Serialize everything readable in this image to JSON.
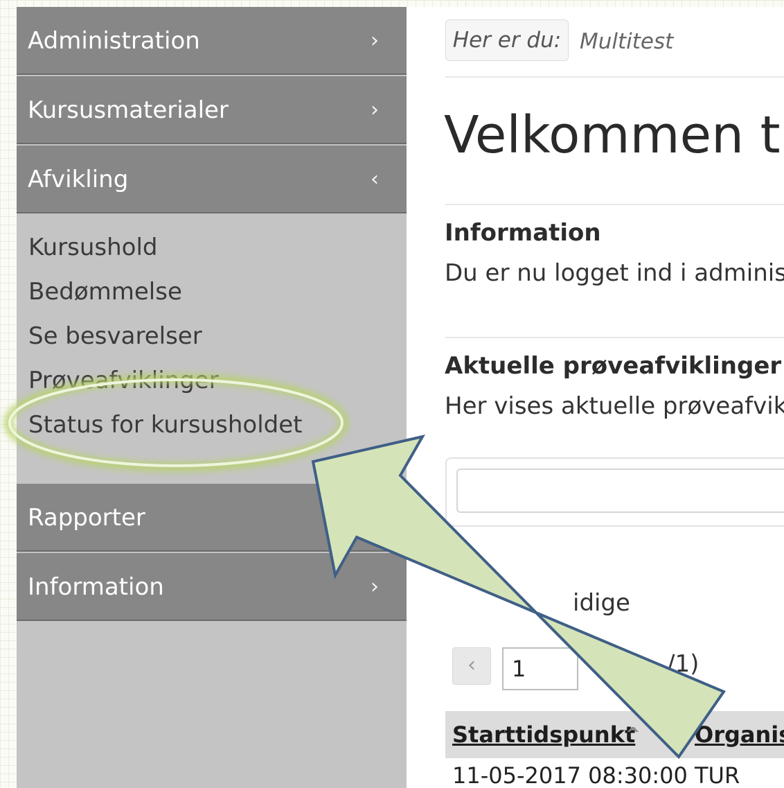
{
  "sidebar": {
    "items": [
      {
        "label": "Administration",
        "chevron": "›"
      },
      {
        "label": "Kursusmaterialer",
        "chevron": "›"
      },
      {
        "label": "Afvikling",
        "chevron": "‹"
      },
      {
        "label": "Rapporter",
        "chevron": ""
      },
      {
        "label": "Information",
        "chevron": "›"
      }
    ],
    "submenu": [
      "Kursushold",
      "Bedømmelse",
      "Se besvarelser",
      "Prøveafviklinger",
      "Status for kursusholdet"
    ]
  },
  "breadcrumb": {
    "label": "Her er du:",
    "current": "Multitest"
  },
  "main": {
    "welcome": "Velkommen til",
    "info_title": "Information",
    "info_text": "Du er nu logget ind i adminis",
    "current_title": "Aktuelle prøveafviklinger",
    "current_text": "Her vises aktuelle prøveafvik",
    "earlier_label": "idige",
    "pager": {
      "prev": "‹",
      "page": "1",
      "count": "/1)"
    },
    "table": {
      "headers": [
        "Starttidspunkt",
        "Organis"
      ],
      "sort_indicator": "^",
      "rows": [
        [
          "11-05-2017 08:30:00",
          "TUR"
        ]
      ]
    }
  },
  "annotation": {
    "ellipse_color": "#c8dc9c",
    "arrow_fill": "#d5e3b9",
    "arrow_stroke": "#3f5f86"
  }
}
